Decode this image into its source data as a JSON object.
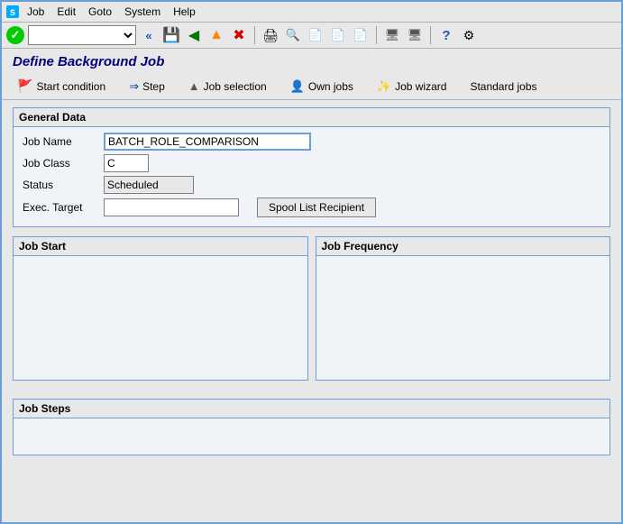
{
  "window": {
    "title": "Define Background Job"
  },
  "menu": {
    "items": [
      "Job",
      "Edit",
      "Goto",
      "System",
      "Help"
    ]
  },
  "toolbar": {
    "select_value": "",
    "select_placeholder": ""
  },
  "page_title": "Define Background Job",
  "nav_tabs": [
    {
      "id": "start-condition",
      "label": "Start condition",
      "icon": "flag"
    },
    {
      "id": "step",
      "label": "Step",
      "icon": "step"
    },
    {
      "id": "job-selection",
      "label": "Job selection",
      "icon": "mountain"
    },
    {
      "id": "own-jobs",
      "label": "Own jobs",
      "icon": "person"
    },
    {
      "id": "job-wizard",
      "label": "Job wizard",
      "icon": "wizard"
    },
    {
      "id": "standard-jobs",
      "label": "Standard jobs",
      "icon": "list"
    }
  ],
  "general_data": {
    "section_title": "General Data",
    "fields": {
      "job_name_label": "Job Name",
      "job_name_value": "BATCH_ROLE_COMPARISON",
      "job_class_label": "Job Class",
      "job_class_value": "C",
      "status_label": "Status",
      "status_value": "Scheduled",
      "exec_target_label": "Exec. Target",
      "exec_target_value": ""
    },
    "spool_btn_label": "Spool List Recipient"
  },
  "job_start": {
    "section_title": "Job Start"
  },
  "job_frequency": {
    "section_title": "Job Frequency"
  },
  "job_steps": {
    "section_title": "Job Steps"
  }
}
